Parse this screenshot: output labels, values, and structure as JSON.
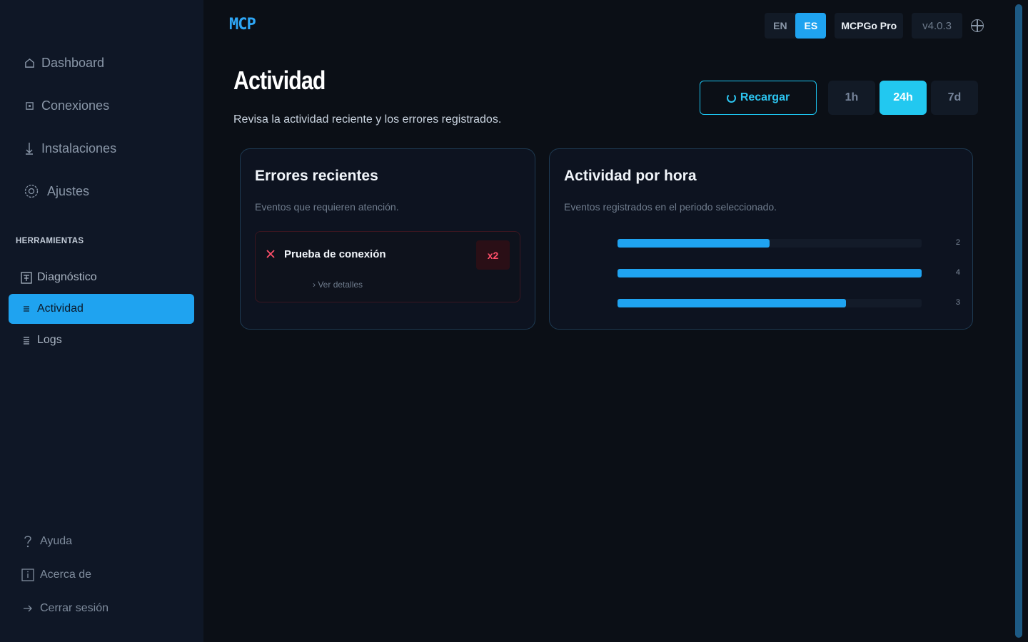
{
  "app": {
    "brand": "MCP"
  },
  "sidebar": {
    "items": [
      {
        "label": "Dashboard",
        "icon": "home-icon"
      },
      {
        "label": "Conexiones",
        "icon": "plug-icon"
      },
      {
        "label": "Instalaciones",
        "icon": "download-icon"
      },
      {
        "label": "Ajustes",
        "icon": "gear-icon"
      }
    ],
    "section_title": "HERRAMIENTAS",
    "tools": [
      {
        "label": "Diagnóstico",
        "icon": "diagnostic-icon",
        "active": false
      },
      {
        "label": "Actividad",
        "icon": "activity-icon",
        "active": true
      },
      {
        "label": "Logs",
        "icon": "logs-icon",
        "active": false
      }
    ],
    "bottom": [
      {
        "label": "Ayuda",
        "icon": "help-icon"
      },
      {
        "label": "Acerca de",
        "icon": "info-icon"
      },
      {
        "label": "Cerrar sesión",
        "icon": "logout-icon"
      }
    ]
  },
  "topbar": {
    "languages": [
      "EN",
      "ES"
    ],
    "active_language": "ES",
    "plan": "MCPGo Pro",
    "version": "v4.0.3"
  },
  "page": {
    "title": "Actividad",
    "subtitle": "Revisa la actividad reciente y los errores registrados.",
    "reload_label": "Recargar",
    "ranges": [
      "1h",
      "24h",
      "7d"
    ],
    "active_range": "24h"
  },
  "errors_card": {
    "title": "Errores recientes",
    "description": "Eventos que requieren atención.",
    "items": [
      {
        "name": "Prueba de conexión",
        "count": "x2",
        "details_label": "Ver detalles"
      }
    ]
  },
  "activity_card": {
    "title": "Actividad por hora",
    "description": "Eventos registrados en el periodo seleccionado.",
    "bars": [
      {
        "value": 2
      },
      {
        "value": 4
      },
      {
        "value": 3
      }
    ],
    "max": 4
  },
  "colors": {
    "accent": "#1fa3f0",
    "accent_cyan": "#22c8f0",
    "error": "#ff4f6a",
    "background": "#0b0f16",
    "sidebar": "#0f1726"
  }
}
